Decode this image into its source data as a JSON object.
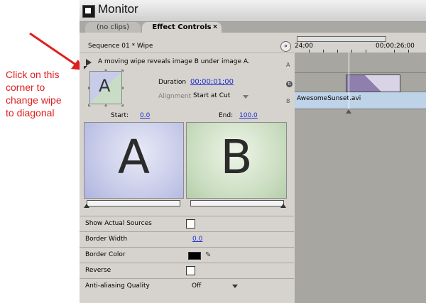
{
  "annotation": {
    "lines": [
      "Click on this",
      "corner to",
      "change wipe",
      "to diagonal"
    ],
    "color": "#e01f1f"
  },
  "window": {
    "title": "Monitor",
    "tabs": [
      {
        "label": "(no clips)"
      },
      {
        "label": "Effect Controls",
        "close": "×"
      }
    ]
  },
  "effect_controls": {
    "sequence": "Sequence 01 * Wipe",
    "description": "A moving wipe reveals image B under image A.",
    "preview_letter": "A",
    "duration_label": "Duration",
    "duration_value": "00;00;01;00",
    "alignment_label": "Alignment",
    "alignment_value": "Start at Cut",
    "track_labels": {
      "a": "A",
      "b": "B"
    },
    "start_label": "Start:",
    "start_value": "0.0",
    "end_label": "End:",
    "end_value": "100.0",
    "image_a_letter": "A",
    "image_b_letter": "B",
    "properties": [
      {
        "label": "Show Actual Sources"
      },
      {
        "label": "Border Width",
        "value": "0.0"
      },
      {
        "label": "Border Color"
      },
      {
        "label": "Reverse"
      },
      {
        "label": "Anti-aliasing Quality",
        "value": "Off"
      }
    ]
  },
  "timeline": {
    "ruler_start": "24;00",
    "ruler_end": "00;00;26;00",
    "clip_name": "AwesomeSunset.avi"
  }
}
